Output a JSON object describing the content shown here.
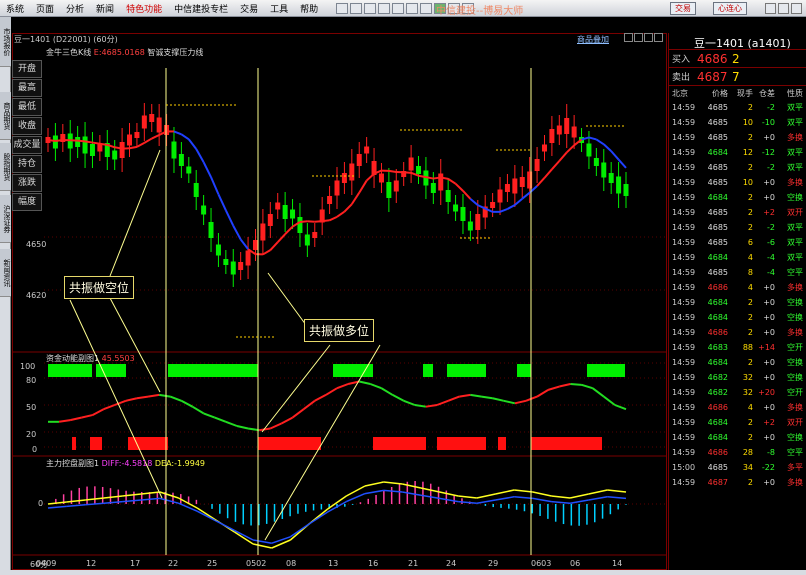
{
  "menu": [
    "系统",
    "页面",
    "分析",
    "新闻",
    "特色功能",
    "中信建投专栏",
    "交易",
    "工具",
    "帮助"
  ],
  "brand_text": "中信建投--博易大师",
  "trade_buttons": [
    "交易",
    "心连心"
  ],
  "sidebar_tabs": [
    "市场报价",
    "商品期货",
    "股指期货",
    "沪深证券",
    "新闻资讯"
  ],
  "chart": {
    "tab": "豆一1401 (D22001) (60分)",
    "indicator_title": "金牛三色K线",
    "indicator_value": "E:4685.0168",
    "indicator_suffix": "智诚支撑压力线",
    "top_right_link": "商品叠加",
    "left_buttons": [
      "开盘",
      "最高",
      "最低",
      "收盘",
      "成交量",
      "持仓",
      "涨跌",
      "幅度"
    ],
    "price_ticks": [
      "4650",
      "4620"
    ],
    "sub1_title": "资金动能副图1",
    "sub1_value": "45.5503",
    "sub1_ticks": [
      "100",
      "80",
      "50",
      "20",
      "0"
    ],
    "sub2_title": "主力控盘副图1",
    "sub2_diff": "DIFF:-4.5818",
    "sub2_dea": "DEA:-1.9949",
    "sub2_ticks": [
      "0"
    ],
    "period": "60分",
    "dates": [
      "0409",
      "12",
      "17",
      "22",
      "25",
      "0502",
      "08",
      "13",
      "16",
      "21",
      "24",
      "29",
      "0603",
      "06",
      "14"
    ],
    "annotation_short": "共振做空位",
    "annotation_long": "共振做多位"
  },
  "quote": {
    "title": "豆一1401 (a1401)",
    "bid_label": "买入",
    "bid_price": "4686",
    "bid_qty": "2",
    "ask_label": "卖出",
    "ask_price": "4687",
    "ask_qty": "7",
    "headers": [
      "北京",
      "价格",
      "现手",
      "仓差",
      "性质"
    ],
    "rows": [
      [
        "14:59",
        "4685",
        "2",
        "-2",
        "双平"
      ],
      [
        "14:59",
        "4685",
        "10",
        "-10",
        "双平"
      ],
      [
        "14:59",
        "4685",
        "2",
        "+0",
        "多换"
      ],
      [
        "14:59",
        "4684",
        "12",
        "-12",
        "双平"
      ],
      [
        "14:59",
        "4685",
        "2",
        "-2",
        "双平"
      ],
      [
        "14:59",
        "4685",
        "10",
        "+0",
        "多换"
      ],
      [
        "14:59",
        "4684",
        "2",
        "+0",
        "空换"
      ],
      [
        "14:59",
        "4685",
        "2",
        "+2",
        "双开"
      ],
      [
        "14:59",
        "4685",
        "2",
        "-2",
        "双平"
      ],
      [
        "14:59",
        "4685",
        "6",
        "-6",
        "双平"
      ],
      [
        "14:59",
        "4684",
        "4",
        "-4",
        "双平"
      ],
      [
        "14:59",
        "4685",
        "8",
        "-4",
        "空平"
      ],
      [
        "14:59",
        "4686",
        "4",
        "+0",
        "多换"
      ],
      [
        "14:59",
        "4684",
        "2",
        "+0",
        "空换"
      ],
      [
        "14:59",
        "4684",
        "2",
        "+0",
        "空换"
      ],
      [
        "14:59",
        "4686",
        "2",
        "+0",
        "多换"
      ],
      [
        "14:59",
        "4683",
        "88",
        "+14",
        "空开"
      ],
      [
        "14:59",
        "4684",
        "2",
        "+0",
        "空换"
      ],
      [
        "14:59",
        "4682",
        "32",
        "+0",
        "空换"
      ],
      [
        "14:59",
        "4682",
        "32",
        "+20",
        "空开"
      ],
      [
        "14:59",
        "4686",
        "4",
        "+0",
        "多换"
      ],
      [
        "14:59",
        "4684",
        "2",
        "+2",
        "双开"
      ],
      [
        "14:59",
        "4684",
        "2",
        "+0",
        "空换"
      ],
      [
        "14:59",
        "4686",
        "28",
        "-8",
        "空平"
      ],
      [
        "15:00",
        "4685",
        "34",
        "-22",
        "多平"
      ],
      [
        "14:59",
        "4687",
        "2",
        "+0",
        "多换"
      ]
    ]
  },
  "colors": {
    "up": "#ff2020",
    "down": "#00ff00",
    "ma": "#0040ff",
    "bg": "#000000"
  }
}
